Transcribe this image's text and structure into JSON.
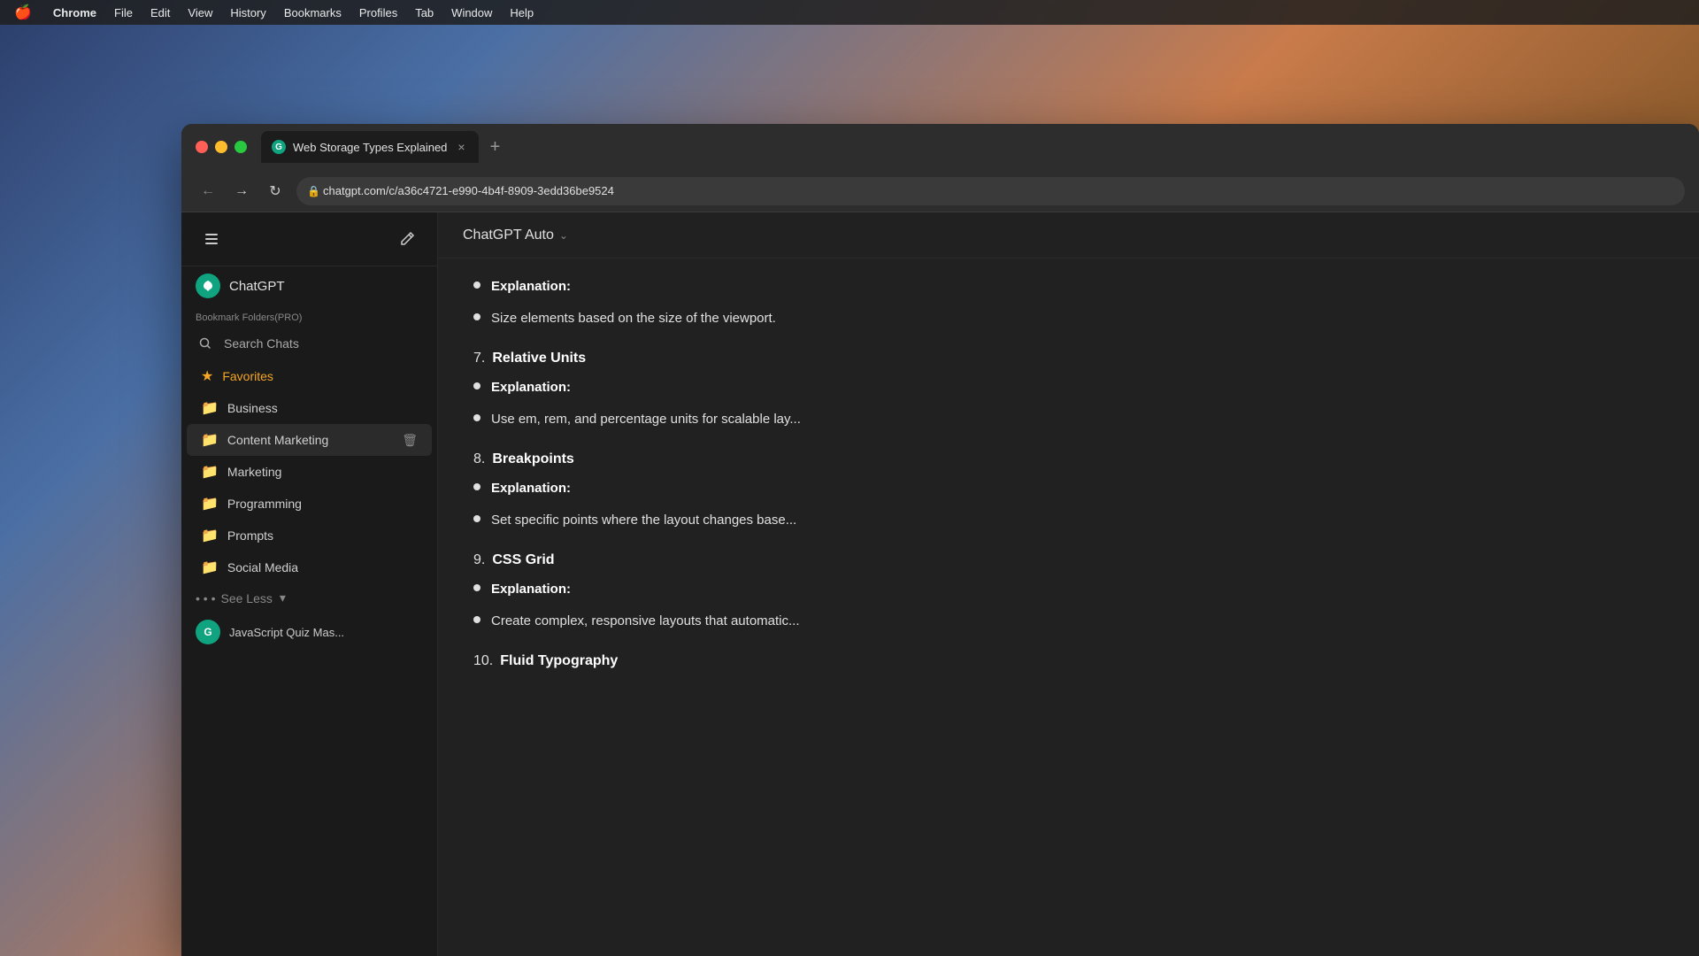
{
  "desktop": {
    "menubar": {
      "apple": "🍎",
      "items": [
        "Chrome",
        "File",
        "Edit",
        "View",
        "History",
        "Bookmarks",
        "Profiles",
        "Tab",
        "Window",
        "Help"
      ]
    }
  },
  "browser": {
    "tab": {
      "favicon_letter": "G",
      "title": "Web Storage Types Explained",
      "close_label": "×"
    },
    "tab_new_label": "+",
    "nav": {
      "back": "←",
      "forward": "→",
      "refresh": "↻",
      "lock": "🔒",
      "url": "chatgpt.com/c/a36c4721-e990-4b4f-8909-3edd36be9524"
    }
  },
  "sidebar": {
    "toggle_icon": "⊞",
    "edit_icon": "✏",
    "chatgpt_icon": "G",
    "chatgpt_label": "ChatGPT",
    "section_label": "Bookmark Folders(PRO)",
    "search_icon": "⌕",
    "search_label": "Search Chats",
    "items": [
      {
        "id": "favorites",
        "icon_type": "star",
        "label": "Favorites",
        "style": "favorites"
      },
      {
        "id": "business",
        "icon_type": "folder",
        "label": "Business"
      },
      {
        "id": "content-marketing",
        "icon_type": "folder",
        "label": "Content Marketing",
        "has_trash": true
      },
      {
        "id": "marketing",
        "icon_type": "folder",
        "label": "Marketing"
      },
      {
        "id": "programming",
        "icon_type": "folder",
        "label": "Programming"
      },
      {
        "id": "prompts",
        "icon_type": "folder",
        "label": "Prompts"
      },
      {
        "id": "social-media",
        "icon_type": "folder",
        "label": "Social Media"
      }
    ],
    "see_less_label": "See Less",
    "see_less_arrow": "▾",
    "recent_chats": [
      {
        "id": "javascript-quiz",
        "avatar": "G",
        "label": "JavaScript Quiz Mas..."
      }
    ]
  },
  "chat": {
    "model_name": "ChatGPT Auto",
    "model_chevron": "⌄",
    "content": {
      "sections": [
        {
          "type": "bullets",
          "items": [
            {
              "bold": "Explanation:",
              "text": ""
            },
            {
              "bold": "",
              "text": "Size elements based on the size of the viewport."
            }
          ]
        },
        {
          "type": "numbered",
          "number": "7.",
          "title": "Relative Units",
          "items": [
            {
              "bold": "Explanation:",
              "text": ""
            },
            {
              "bold": "",
              "text": "Use em, rem, and percentage units for scalable lay..."
            }
          ]
        },
        {
          "type": "numbered",
          "number": "8.",
          "title": "Breakpoints",
          "items": [
            {
              "bold": "Explanation:",
              "text": ""
            },
            {
              "bold": "",
              "text": "Set specific points where the layout changes base..."
            }
          ]
        },
        {
          "type": "numbered",
          "number": "9.",
          "title": "CSS Grid",
          "items": [
            {
              "bold": "Explanation:",
              "text": ""
            },
            {
              "bold": "",
              "text": "Create complex, responsive layouts that automatic..."
            }
          ]
        },
        {
          "type": "numbered",
          "number": "10.",
          "title": "Fluid Typography",
          "items": []
        }
      ]
    }
  }
}
